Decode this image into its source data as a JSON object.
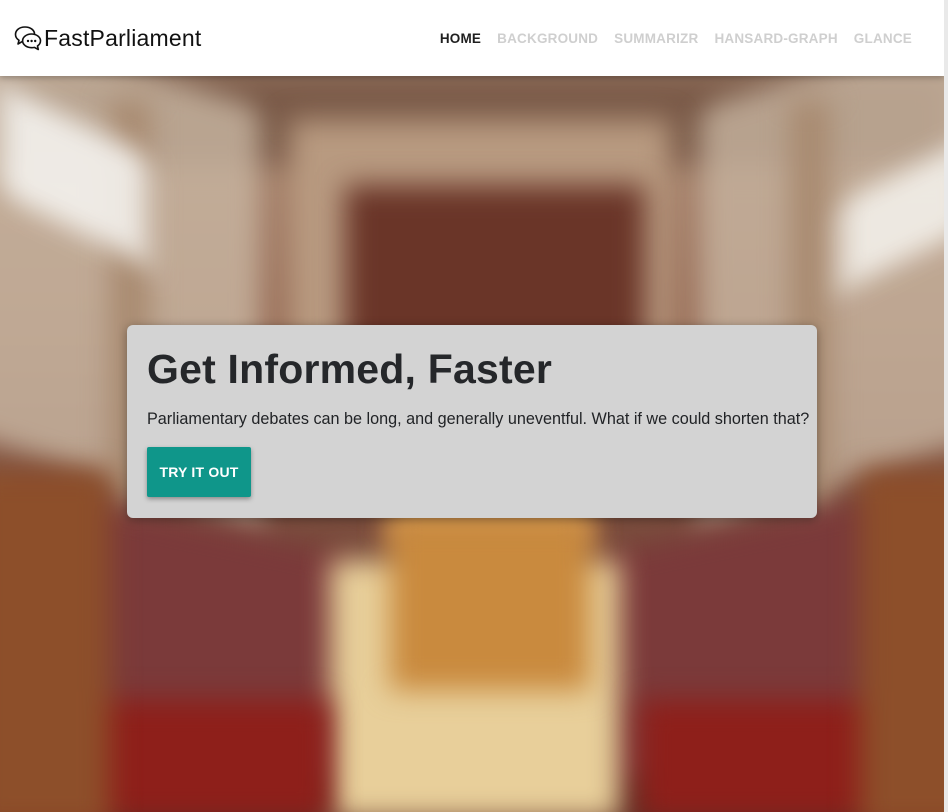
{
  "brand": {
    "name": "FastParliament",
    "icon": "chat-bubbles-icon"
  },
  "nav": {
    "items": [
      {
        "label": "HOME",
        "active": true
      },
      {
        "label": "BACKGROUND",
        "active": false
      },
      {
        "label": "SUMMARIZR",
        "active": false
      },
      {
        "label": "HANSARD-GRAPH",
        "active": false
      },
      {
        "label": "GLANCE",
        "active": false
      }
    ]
  },
  "hero": {
    "title": "Get Informed, Faster",
    "subtitle": "Parliamentary debates can be long, and generally uneventful. What if we could shorten that?",
    "cta_label": "TRY IT OUT",
    "background": "blurred-parliament-chamber-photo"
  },
  "colors": {
    "accent": "#0f968a",
    "card": "#d3d3d3",
    "nav_active": "#1f1f1f",
    "nav_inactive": "#cfcfcf"
  }
}
